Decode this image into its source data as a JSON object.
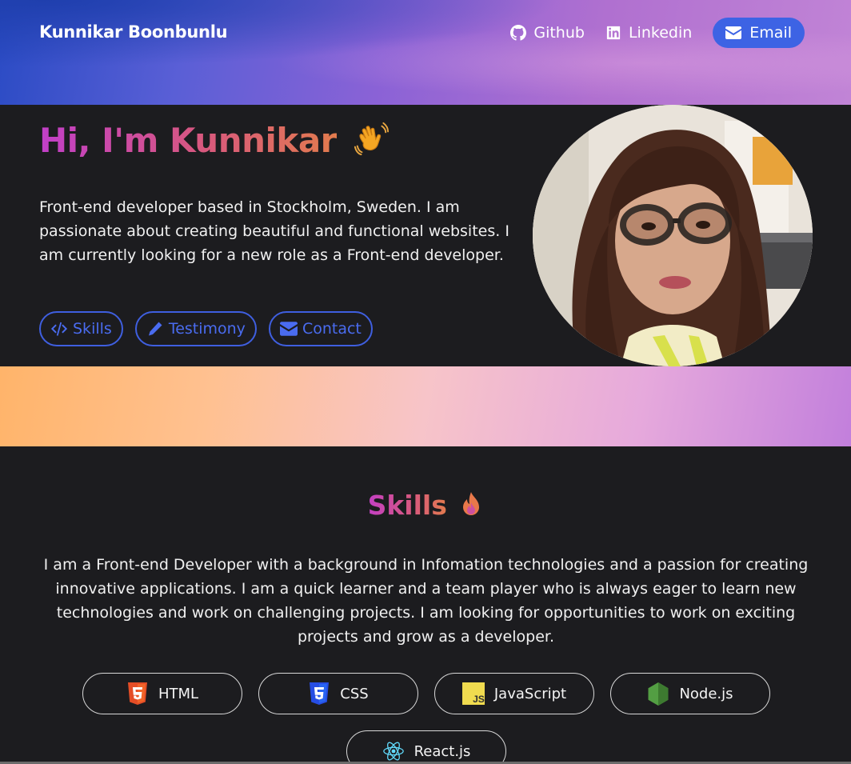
{
  "header": {
    "brand": "Kunnikar Boonbunlu",
    "nav": {
      "github": "Github",
      "linkedin": "Linkedin",
      "email": "Email"
    }
  },
  "hero": {
    "greeting": "Hi, I'm Kunnikar",
    "wave_icon": "waving-hand-emoji",
    "description": "Front-end developer based in Stockholm, Sweden. I am passionate about creating beautiful and functional websites. I am currently looking for a new role as a Front-end developer.",
    "buttons": {
      "skills": "Skills",
      "testimony": "Testimony",
      "contact": "Contact"
    }
  },
  "skills": {
    "title": "Skills",
    "title_icon": "fire-emoji",
    "description": "I am a Front-end Developer with a background in Infomation technologies and a passion for creating innovative applications. I am a quick learner and a team player who is always eager to learn new technologies and work on challenging projects. I am looking for opportunities to work on exciting projects and grow as a developer.",
    "chips": [
      "HTML",
      "CSS",
      "JavaScript",
      "Node.js",
      "React.js"
    ]
  },
  "colors": {
    "accent": "#3d63e4",
    "background": "#1c1c1f",
    "html_orange": "#e44d26",
    "css_blue": "#264de4",
    "js_yellow": "#f0db4f",
    "node_green": "#539e43",
    "react_cyan": "#61dafb"
  }
}
